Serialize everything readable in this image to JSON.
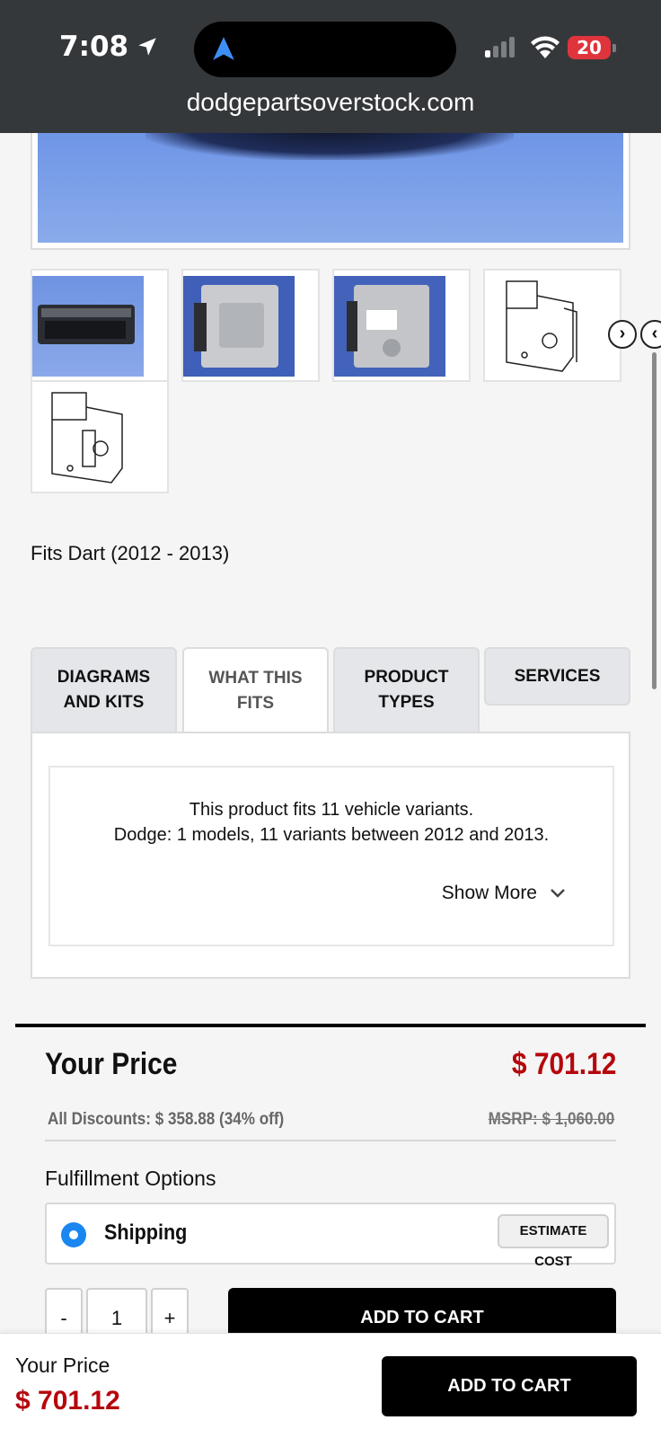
{
  "status_bar": {
    "time": "7:08",
    "battery": "20",
    "signal_bars_active": 1,
    "signal_bars_total": 4
  },
  "browser": {
    "url": "dodgepartsoverstock.com"
  },
  "gallery": {
    "thumbnails": [
      {
        "name": "module-photo-side",
        "style": "blue"
      },
      {
        "name": "module-photo-top",
        "style": "blue"
      },
      {
        "name": "module-photo-label",
        "style": "blue"
      },
      {
        "name": "module-line-drawing-1",
        "style": "drawing"
      },
      {
        "name": "module-line-drawing-2",
        "style": "drawing"
      }
    ],
    "next_icon": "›",
    "prev_icon": "‹"
  },
  "product": {
    "fits_title": "Fits Dart (2012 - 2013)"
  },
  "tabs": [
    {
      "label": "DIAGRAMS AND KITS",
      "active": false
    },
    {
      "label": "WHAT THIS FITS",
      "active": true
    },
    {
      "label": "PRODUCT TYPES",
      "active": false
    },
    {
      "label": "SERVICES",
      "active": false
    }
  ],
  "fitment": {
    "line1": "This product fits 11 vehicle variants.",
    "line2": "Dodge: 1 models, 11 variants between 2012 and 2013.",
    "show_more": "Show More"
  },
  "pricing": {
    "your_price_label": "Your Price",
    "price": "$ 701.12",
    "discounts": "All Discounts: $ 358.88 (34% off)",
    "msrp": "MSRP: $ 1,060.00",
    "fulfillment_label": "Fulfillment Options",
    "shipping_label": "Shipping",
    "estimate_cost": "ESTIMATE COST",
    "qty_minus": "-",
    "qty_value": "1",
    "qty_plus": "+",
    "add_to_cart": "ADD TO CART"
  },
  "sticky_bar": {
    "label": "Your Price",
    "price": "$ 701.12",
    "add_to_cart": "ADD TO CART"
  },
  "colors": {
    "price_red": "#b5070d",
    "radio_blue": "#1a86f0",
    "topbar": "#35383b",
    "battery_red": "#e0343d"
  }
}
